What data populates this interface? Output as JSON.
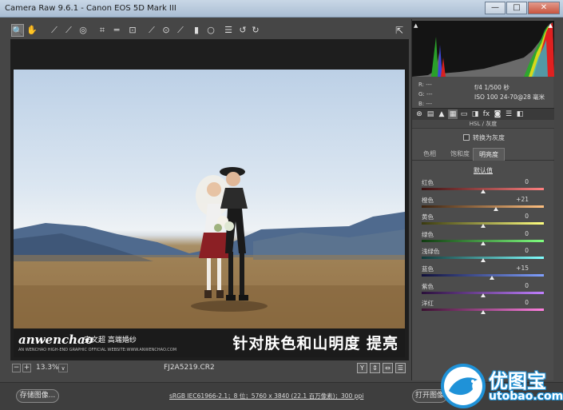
{
  "window": {
    "title": "Camera Raw 9.6.1 -  Canon EOS 5D Mark III",
    "min": "—",
    "max": "□",
    "close": "✕"
  },
  "toolbar": {
    "tools": [
      {
        "name": "zoom-tool-icon",
        "glyph": "🔍"
      },
      {
        "name": "hand-tool-icon",
        "glyph": "✋"
      },
      {
        "name": "white-balance-tool-icon",
        "glyph": "⟋"
      },
      {
        "name": "color-sampler-tool-icon",
        "glyph": "⟋"
      },
      {
        "name": "targeted-adjustment-tool-icon",
        "glyph": "◎"
      },
      {
        "name": "crop-tool-icon",
        "glyph": "⌗"
      },
      {
        "name": "straighten-tool-icon",
        "glyph": "═"
      },
      {
        "name": "transform-tool-icon",
        "glyph": "⊡"
      },
      {
        "name": "spot-removal-tool-icon",
        "glyph": "⟋"
      },
      {
        "name": "red-eye-tool-icon",
        "glyph": "⊙"
      },
      {
        "name": "adjustment-brush-icon",
        "glyph": "⟋"
      },
      {
        "name": "graduated-filter-icon",
        "glyph": "▮"
      },
      {
        "name": "radial-filter-icon",
        "glyph": "○"
      },
      {
        "name": "preferences-icon",
        "glyph": "☰"
      },
      {
        "name": "rotate-left-icon",
        "glyph": "↺"
      },
      {
        "name": "rotate-right-icon",
        "glyph": "↻"
      }
    ],
    "open_glyph": "⇱"
  },
  "image": {
    "watermark_logo": "anwenchao",
    "watermark_cn": "安文超 高端婚纱",
    "watermark_sub": "AN WENCHAO  HIGH-END  GRAPHIC  OFFICIAL  WEBSITE:WWW.ANWENCHAO.COM",
    "caption": "针对肤色和山明度  提亮"
  },
  "status": {
    "zoom_minus": "−",
    "zoom_plus": "+",
    "zoom": "13.3%",
    "zoom_dropdown": "∨",
    "filename": "FJ2A5219.CR2",
    "view_buttons": [
      "Y",
      "⇕",
      "⇔",
      "☰"
    ]
  },
  "bottom": {
    "save_label": "存储图像...",
    "workflow": "sRGB IEC61966-2.1；8 位；5760 x 3840 (22.1 百万像素)；300 ppi",
    "open_label": "打开图像"
  },
  "histogram": {
    "clip_left": "▲",
    "clip_right": "▲"
  },
  "readout": {
    "r": "R:  ---",
    "g": "G:  ---",
    "b": "B:  ---"
  },
  "camera": {
    "line1": "f/4   1/500 秒",
    "line2": "ISO 100   24-70@28 毫米"
  },
  "panel_tabs": [
    "⊛",
    "▤",
    "▲",
    "▦",
    "▭",
    "◨",
    "fx",
    "◙",
    "☰",
    "◧"
  ],
  "panel": {
    "section_title": "HSL / 灰度",
    "convert_label": "转换为灰度",
    "subtabs": [
      "色相",
      "饱和度",
      "明亮度"
    ],
    "default_label": "默认值"
  },
  "sliders": [
    {
      "label": "红色",
      "value": "0",
      "num": 0,
      "colors": [
        "#3a1010",
        "#ff8080"
      ]
    },
    {
      "label": "橙色",
      "value": "+21",
      "num": 21,
      "colors": [
        "#3a2210",
        "#ffc080"
      ]
    },
    {
      "label": "黄色",
      "value": "0",
      "num": 0,
      "colors": [
        "#3a3a10",
        "#ffff80"
      ]
    },
    {
      "label": "绿色",
      "value": "0",
      "num": 0,
      "colors": [
        "#103a10",
        "#80ff80"
      ]
    },
    {
      "label": "浅绿色",
      "value": "0",
      "num": 0,
      "colors": [
        "#103a3a",
        "#80ffff"
      ]
    },
    {
      "label": "蓝色",
      "value": "+15",
      "num": 15,
      "colors": [
        "#10103a",
        "#80a0ff"
      ]
    },
    {
      "label": "紫色",
      "value": "0",
      "num": 0,
      "colors": [
        "#2a103a",
        "#c080ff"
      ]
    },
    {
      "label": "洋红",
      "value": "0",
      "num": 0,
      "colors": [
        "#3a1030",
        "#ff80e0"
      ]
    }
  ],
  "site_logo": {
    "cn": "优图宝",
    "en": "utobao.com"
  }
}
